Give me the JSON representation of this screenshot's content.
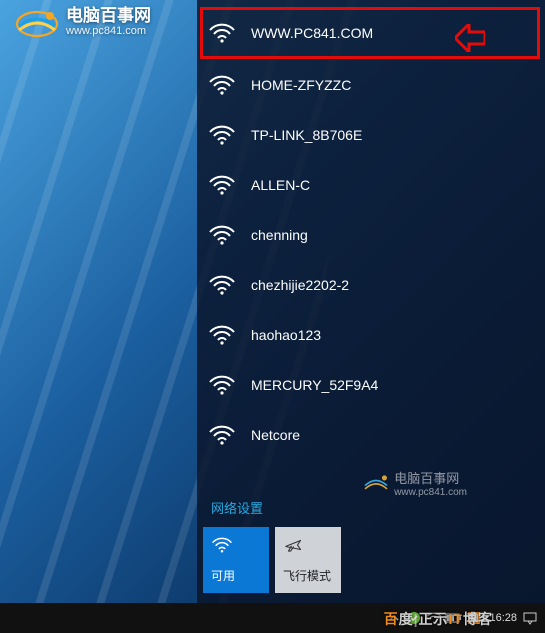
{
  "watermark": {
    "cn": "电脑百事网",
    "url": "www.pc841.com"
  },
  "wifi_panel": {
    "networks": [
      {
        "ssid": "WWW.PC841.COM",
        "highlighted": true
      },
      {
        "ssid": "HOME-ZFYZZC"
      },
      {
        "ssid": "TP-LINK_8B706E"
      },
      {
        "ssid": "ALLEN-C"
      },
      {
        "ssid": "chenning"
      },
      {
        "ssid": "chezhijie2202-2"
      },
      {
        "ssid": "haohao123"
      },
      {
        "ssid": "MERCURY_52F9A4"
      },
      {
        "ssid": "Netcore"
      }
    ],
    "settings_label": "网络设置",
    "tiles": {
      "wifi": {
        "label": "可用",
        "state": "on"
      },
      "airplane": {
        "label": "飞行模式",
        "state": "off"
      }
    }
  },
  "taskbar": {
    "clock": "16:28",
    "overlay": "百度|正示IT博客"
  },
  "watermark_mid": {
    "cn": "电脑百事网",
    "url": "www.pc841.com"
  },
  "colors": {
    "highlight_outline": "#e40b0b",
    "tile_on": "#0a78d4",
    "link_blue": "#2aa9e0"
  }
}
